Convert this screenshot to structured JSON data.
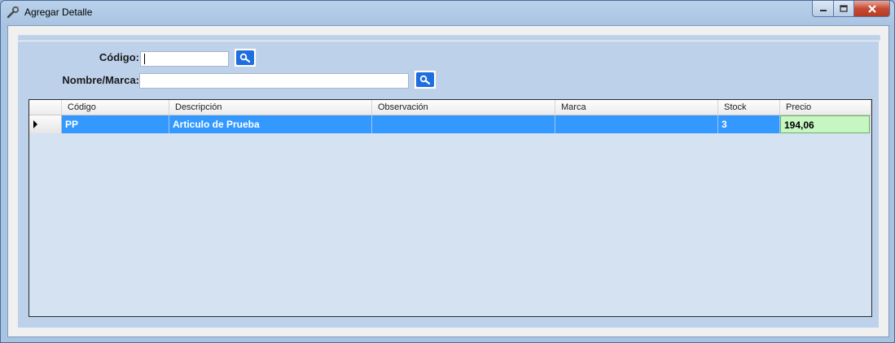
{
  "window": {
    "title": "Agregar Detalle",
    "icon": "tools-icon"
  },
  "form": {
    "codigo_label": "Código:",
    "codigo_value": "",
    "nombre_label": "Nombre/Marca:",
    "nombre_value": "",
    "search_icon": "magnifier-icon"
  },
  "grid": {
    "columns": [
      "Código",
      "Descripción",
      "Observación",
      "Marca",
      "Stock",
      "Precio"
    ],
    "rows": [
      {
        "codigo": "PP",
        "descripcion": "Articulo de Prueba",
        "observacion": "",
        "marca": "",
        "stock": "3",
        "precio": "194,06"
      }
    ]
  },
  "colors": {
    "selection": "#3399ff",
    "price_cell": "#c6f7c2",
    "panel": "#bdd1ea"
  }
}
